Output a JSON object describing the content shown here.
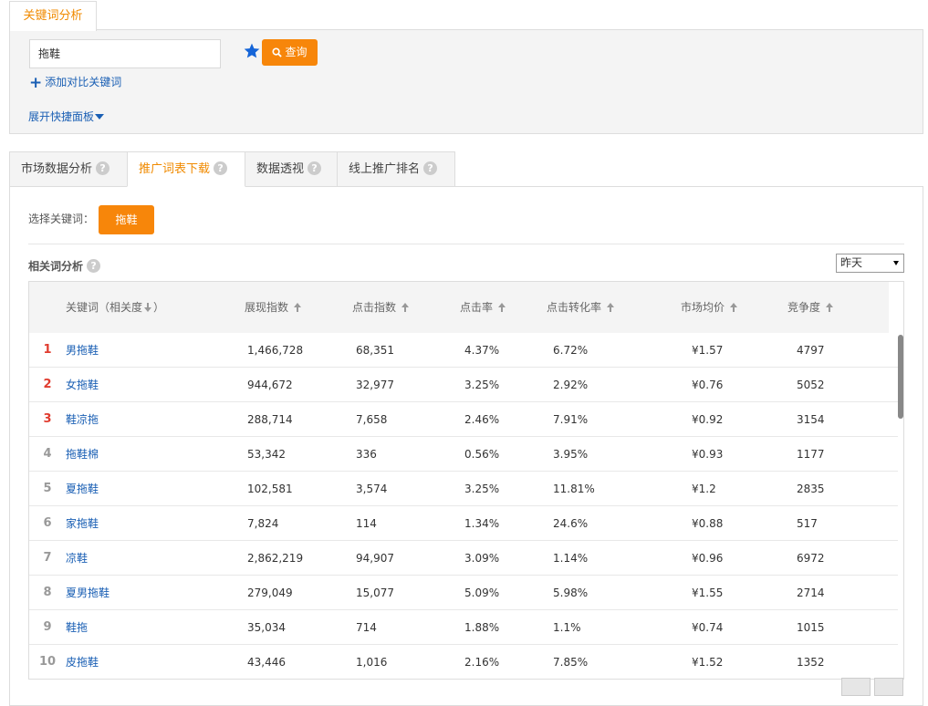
{
  "top_tab": {
    "label": "关键词分析"
  },
  "search": {
    "value": "拖鞋",
    "query_label": "查询",
    "add_compare_label": "添加对比关键词",
    "expand_label": "展开快捷面板"
  },
  "tabs": [
    {
      "label": "市场数据分析",
      "active": false
    },
    {
      "label": "推广词表下载",
      "active": true
    },
    {
      "label": "数据透视",
      "active": false
    },
    {
      "label": "线上推广排名",
      "active": false
    }
  ],
  "main": {
    "select_label": "选择关键词：",
    "selected_keyword": "拖鞋",
    "related_title": "相关词分析",
    "date_option": "昨天"
  },
  "table": {
    "headers": {
      "keyword": "关键词（相关度",
      "keyword_suffix": "）",
      "impressions": "展现指数",
      "clicks": "点击指数",
      "ctr": "点击率",
      "cvr": "点击转化率",
      "avg_price": "市场均价",
      "competition": "竞争度"
    },
    "rows": [
      {
        "rank": "1",
        "keyword": "男拖鞋",
        "impressions": "1,466,728",
        "clicks": "68,351",
        "ctr": "4.37%",
        "cvr": "6.72%",
        "avg_price": "¥1.57",
        "competition": "4797"
      },
      {
        "rank": "2",
        "keyword": "女拖鞋",
        "impressions": "944,672",
        "clicks": "32,977",
        "ctr": "3.25%",
        "cvr": "2.92%",
        "avg_price": "¥0.76",
        "competition": "5052"
      },
      {
        "rank": "3",
        "keyword": "鞋凉拖",
        "impressions": "288,714",
        "clicks": "7,658",
        "ctr": "2.46%",
        "cvr": "7.91%",
        "avg_price": "¥0.92",
        "competition": "3154"
      },
      {
        "rank": "4",
        "keyword": "拖鞋棉",
        "impressions": "53,342",
        "clicks": "336",
        "ctr": "0.56%",
        "cvr": "3.95%",
        "avg_price": "¥0.93",
        "competition": "1177"
      },
      {
        "rank": "5",
        "keyword": "夏拖鞋",
        "impressions": "102,581",
        "clicks": "3,574",
        "ctr": "3.25%",
        "cvr": "11.81%",
        "avg_price": "¥1.2",
        "competition": "2835"
      },
      {
        "rank": "6",
        "keyword": "家拖鞋",
        "impressions": "7,824",
        "clicks": "114",
        "ctr": "1.34%",
        "cvr": "24.6%",
        "avg_price": "¥0.88",
        "competition": "517"
      },
      {
        "rank": "7",
        "keyword": "凉鞋",
        "impressions": "2,862,219",
        "clicks": "94,907",
        "ctr": "3.09%",
        "cvr": "1.14%",
        "avg_price": "¥0.96",
        "competition": "6972"
      },
      {
        "rank": "8",
        "keyword": "夏男拖鞋",
        "impressions": "279,049",
        "clicks": "15,077",
        "ctr": "5.09%",
        "cvr": "5.98%",
        "avg_price": "¥1.55",
        "competition": "2714"
      },
      {
        "rank": "9",
        "keyword": "鞋拖",
        "impressions": "35,034",
        "clicks": "714",
        "ctr": "1.88%",
        "cvr": "1.1%",
        "avg_price": "¥0.74",
        "competition": "1015"
      },
      {
        "rank": "10",
        "keyword": "皮拖鞋",
        "impressions": "43,446",
        "clicks": "1,016",
        "ctr": "2.16%",
        "cvr": "7.85%",
        "avg_price": "¥1.52",
        "competition": "1352"
      }
    ]
  },
  "colors": {
    "accent": "#f7860a",
    "link": "#1a5fb4",
    "rank_top": "#e03c2f"
  }
}
